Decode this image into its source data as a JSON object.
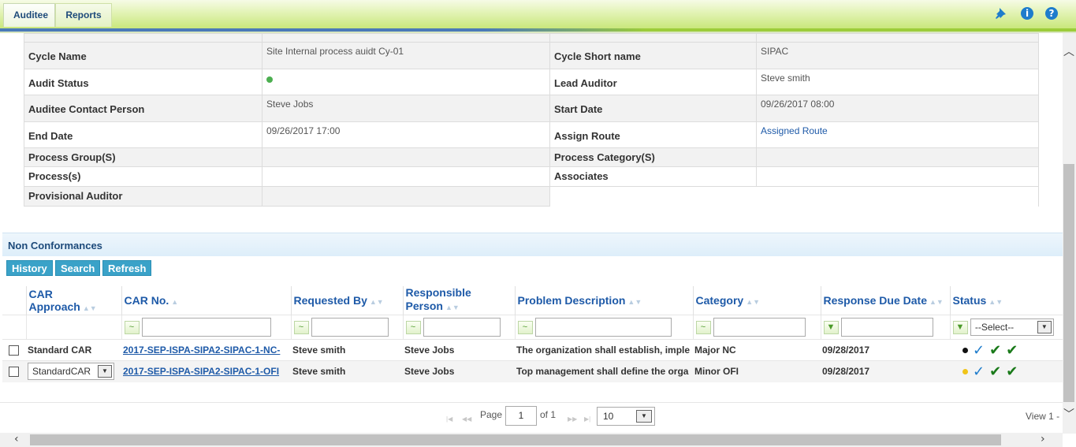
{
  "topbar": {
    "tabs": [
      "Auditee",
      "Reports"
    ],
    "icons": [
      "pin-icon",
      "info-icon",
      "help-icon"
    ],
    "info_glyph": "i",
    "help_glyph": "?"
  },
  "audit": {
    "cycle_name_label": "Cycle Name",
    "cycle_name": "Site Internal process auidt Cy-01",
    "cycle_short_name_label": "Cycle Short name",
    "cycle_short_name": "SIPAC",
    "audit_status_label": "Audit Status",
    "audit_status_color": "#4caf50",
    "lead_auditor_label": "Lead Auditor",
    "lead_auditor": "Steve smith",
    "auditee_contact_label": "Auditee Contact Person",
    "auditee_contact": "Steve Jobs",
    "start_date_label": "Start Date",
    "start_date": "09/26/2017 08:00",
    "end_date_label": "End Date",
    "end_date": "09/26/2017 17:00",
    "assign_route_label": "Assign Route",
    "assign_route": "Assigned Route",
    "process_group_label": "Process Group(S)",
    "process_category_label": "Process Category(S)",
    "process_label": "Process(s)",
    "associates_label": "Associates",
    "provisional_auditor_label": "Provisional Auditor"
  },
  "nc": {
    "title": "Non Conformances",
    "buttons": [
      "History",
      "Search",
      "Refresh"
    ],
    "columns": [
      "CAR Approach",
      "CAR No.",
      "Requested By",
      "Responsible Person",
      "Problem Description",
      "Category",
      "Response Due Date",
      "Status"
    ],
    "status_filter": "--Select--",
    "rows": [
      {
        "approach": "Standard CAR",
        "car_no": "2017-SEP-ISPA-SIPA2-SIPAC-1-NC-",
        "requested_by": "Steve smith",
        "responsible": "Steve Jobs",
        "problem": "The organization shall establish, imple",
        "category": "Major NC",
        "due_date": "09/28/2017",
        "status_color": "#111111"
      },
      {
        "approach": "StandardCAR",
        "car_no": "2017-SEP-ISPA-SIPA2-SIPAC-1-OFI",
        "requested_by": "Steve smith",
        "responsible": "Steve Jobs",
        "problem": "Top management shall define the orga",
        "category": "Minor OFI",
        "due_date": "09/28/2017",
        "status_color": "#f0c419"
      }
    ],
    "tick_glyph": "✓",
    "bold_tick_glyph": "✔"
  },
  "pager": {
    "page_label": "Page",
    "page_value": "1",
    "of_label": "of 1",
    "page_size": "10",
    "view_label": "View 1 -"
  }
}
